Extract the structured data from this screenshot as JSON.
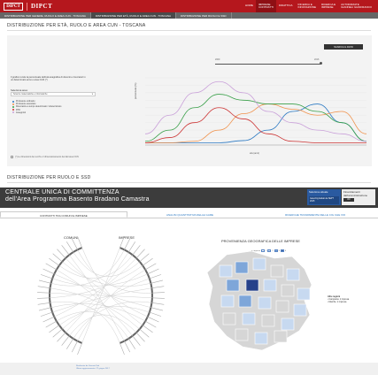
{
  "brand": {
    "logo_text": "DIPCT",
    "mark": "DIPCT"
  },
  "nav": [
    {
      "label": "HOME",
      "active": false
    },
    {
      "label": "IMPRESE\nCONTRATTI",
      "active": true
    },
    {
      "label": "DIDATTICA",
      "active": false
    },
    {
      "label": "RICERCA E\nINNOVAZIONE",
      "active": false
    },
    {
      "label": "RICERCA E\nIMPRESE",
      "active": false
    },
    {
      "label": "AUTORIZZATE\nGIANNELI GIANFRANCO",
      "active": false
    }
  ],
  "tabs": [
    {
      "label": "DISTRIBUZIONE PER GENERE, RUOLO E AREA CUN - TOSCANA",
      "active": false
    },
    {
      "label": "DISTRIBUZIONE PER ETÀ, RUOLO E AREA CUN - TOSCANA",
      "active": true
    },
    {
      "label": "DISTRIBUZIONE PER RUOLO E SSD",
      "active": false
    }
  ],
  "section1": {
    "title": "DISTRIBUZIONE PER ETÀ, RUOLO E AREA CUN - TOSCANA",
    "download_label": "SCARICA IL DATO",
    "slider_start": "2009",
    "slider_end": "2016",
    "description": "Il grafico rende la percentuale dell'età anagrafica di docenti e ricercatori in un determinato anno e area CUN (*)",
    "area_label": "Seleziona area:",
    "select_value": "Scienze matematiche e informatiche",
    "legend": [
      {
        "label": "Professore ordinario",
        "color": "#2a78c2"
      },
      {
        "label": "Professore associato",
        "color": "#f0924c"
      },
      {
        "label": "Ricercatore a tempo determinato / indeterminato",
        "color": "#3aa04a"
      },
      {
        "label": "RTD",
        "color": "#c33"
      },
      {
        "label": "Assegnisti",
        "color": "#c9a0d9"
      }
    ],
    "checkbox_label": "(*) Le dimensioni dei cerchi e il dimensionamento dei dati area CUN",
    "y_label": "percentuale (%)",
    "x_label": "età (anni)"
  },
  "section2": {
    "title": "DISTRIBUZIONE PER RUOLO E SSD",
    "cuc_title_1": "CENTRALE UNICA DI COMMITTENZA",
    "cuc_title_2": "dell'Area Programma Basento Bradano Camastra",
    "selezione_label": "Selezione attuale",
    "selezione_value": "Gare/Cig Esitati da SEPT 2015",
    "fin_label": "Finanziamenti dall'amministrazione",
    "fin_button": "VAI",
    "subtabs": [
      {
        "label": "CONTRATTI TRA COMUNI E IMPRESE",
        "active": true
      },
      {
        "label": "ANALISI QUANTITATIVA DELLE GARE",
        "active": false
      },
      {
        "label": "RICERCHE TRASPARENTE DELLE CIG CHE VOI",
        "active": false
      }
    ],
    "chord_left_label": "COMUNI",
    "chord_right_label": "IMPRESE",
    "map_title": "PROVENIENZA GEOGRAFICA DELLE IMPRESE",
    "map_scale_label": "n. imprese",
    "map_scale_values": [
      "1",
      "2",
      "3",
      "4"
    ],
    "map_legend_title": "Altre regioni",
    "map_legend_items": [
      "Campania: 1 impresa",
      "Marche: 1 impresa"
    ]
  },
  "footer": {
    "line1": "Realizzato da Venezia Dati",
    "line2": "Ultimo aggiornamento: 27 giugno 2017"
  },
  "chart_data": {
    "type": "line",
    "xlabel": "età (anni)",
    "ylabel": "percentuale (%)",
    "series": [
      {
        "name": "Professore ordinario",
        "color": "#2a78c2",
        "values": [
          0.3,
          0.3,
          0.3,
          0.3,
          0.6,
          2,
          4.5,
          5.5,
          3,
          0.5
        ]
      },
      {
        "name": "Professore associato",
        "color": "#f0924c",
        "values": [
          0.3,
          0.3,
          0.5,
          2,
          4.2,
          5.5,
          4.8,
          4,
          4.5,
          1.5
        ]
      },
      {
        "name": "Ricercatore a tempo determinato / indeterminato",
        "color": "#3aa04a",
        "values": [
          0.5,
          2,
          5,
          6.8,
          6,
          5.5,
          5.5,
          4.5,
          3,
          0.5
        ]
      },
      {
        "name": "RTD",
        "color": "#c33",
        "values": [
          0.3,
          1,
          3,
          5,
          3.5,
          1.5,
          0.5,
          0.3,
          0.3,
          0.3
        ]
      },
      {
        "name": "Assegnisti",
        "color": "#c9a0d9",
        "values": [
          1.5,
          4,
          7,
          8.5,
          7,
          4.5,
          3,
          2,
          1.5,
          0.5
        ]
      }
    ]
  }
}
